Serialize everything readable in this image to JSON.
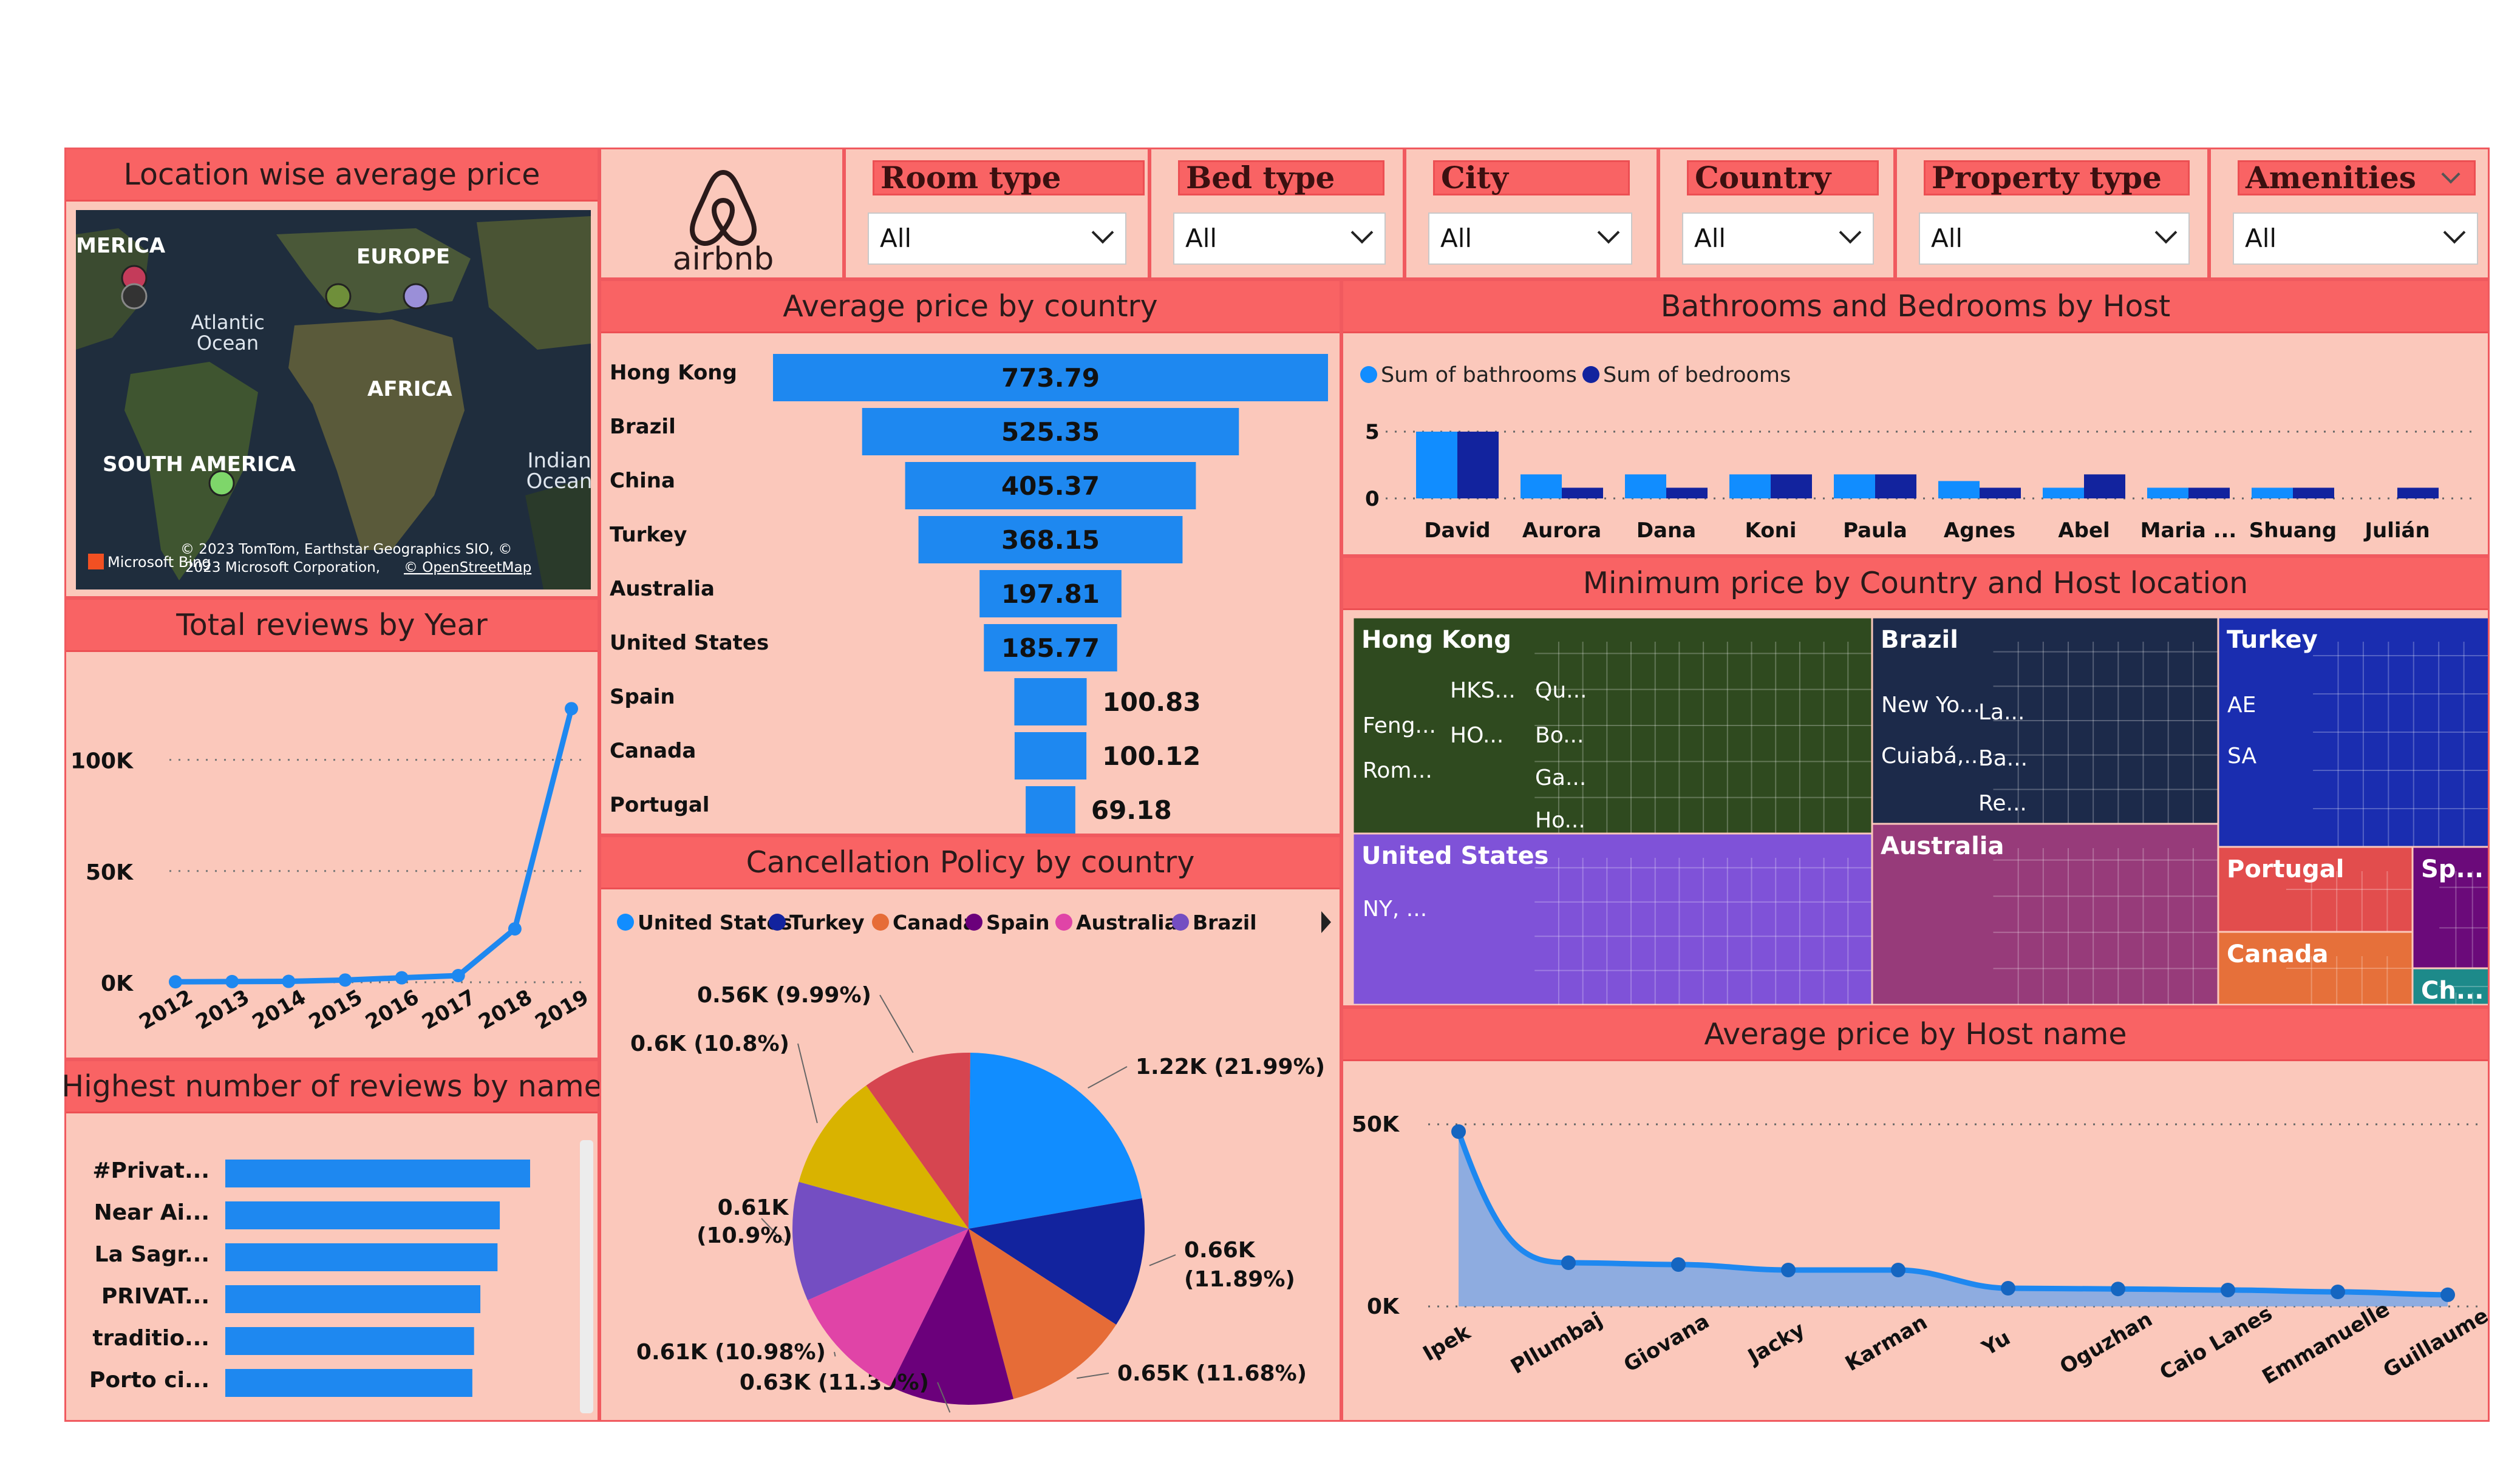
{
  "brand": {
    "name": "airbnb"
  },
  "filters": [
    {
      "title": "Room type",
      "value": "All"
    },
    {
      "title": "Bed type",
      "value": "All"
    },
    {
      "title": "City",
      "value": "All"
    },
    {
      "title": "Country",
      "value": "All"
    },
    {
      "title": "Property type",
      "value": "All"
    },
    {
      "title": "Amenities",
      "value": "All"
    }
  ],
  "panels": {
    "map": "Location wise average price",
    "reviews_year": "Total reviews by Year",
    "reviews_name": "Highest number of reviews by name",
    "avg_country": "Average price by country",
    "cancel": "Cancellation Policy by country",
    "bath_bed": "Bathrooms and Bedrooms by Host",
    "min_price": "Minimum price by Country and Host location",
    "avg_host": "Average  price by Host name"
  },
  "map": {
    "labels": [
      "MERICA",
      "EUROPE",
      "Atlantic",
      "Ocean",
      "AFRICA",
      "SOUTH AMERICA",
      "Indian",
      "Ocean"
    ],
    "attribution_1": "© 2023 TomTom, Earthstar Geographics SIO, ©",
    "attribution_2": "2023 Microsoft Corporation,",
    "attribution_link": "© OpenStreetMap",
    "bing": "Microsoft Bing"
  },
  "chart_data": [
    {
      "id": "reviews_year",
      "type": "line",
      "title": "Total reviews by Year",
      "x": [
        "2012",
        "2013",
        "2014",
        "2015",
        "2016",
        "2017",
        "2018",
        "2019"
      ],
      "values": [
        200,
        300,
        400,
        1000,
        2000,
        3000,
        24000,
        123000
      ],
      "yticks": [
        "0K",
        "50K",
        "100K"
      ],
      "ylim": [
        0,
        125000
      ]
    },
    {
      "id": "reviews_name",
      "type": "bar",
      "title": "Highest number of reviews by name",
      "categories": [
        "#Privat...",
        "Near Ai...",
        "La Sagr...",
        "PRIVAT...",
        "traditio...",
        "Porto ci..."
      ],
      "values": [
        533,
        480,
        476,
        446,
        435,
        432
      ]
    },
    {
      "id": "avg_country",
      "type": "bar",
      "title": "Average price by country",
      "categories": [
        "Hong Kong",
        "Brazil",
        "China",
        "Turkey",
        "Australia",
        "United States",
        "Spain",
        "Canada",
        "Portugal"
      ],
      "values": [
        773.79,
        525.35,
        405.37,
        368.15,
        197.81,
        185.77,
        100.83,
        100.12,
        69.18
      ],
      "labels": [
        "773.79",
        "525.35",
        "405.37",
        "368.15",
        "197.81",
        "185.77",
        "100.83",
        "100.12",
        "69.18"
      ]
    },
    {
      "id": "cancel",
      "type": "pie",
      "title": "Cancellation Policy by country",
      "legend": [
        "United States",
        "Turkey",
        "Canada",
        "Spain",
        "Australia",
        "Brazil"
      ],
      "values": [
        21.99,
        11.89,
        11.68,
        11.39,
        10.98,
        10.9,
        10.8,
        9.99
      ],
      "labels": [
        "1.22K (21.99%)",
        "0.66K (11.89%)",
        "0.65K (11.68%)",
        "0.63K (11.39%)",
        "0.61K (10.98%)",
        "0.61K (10.9%)",
        "0.6K (10.8%)",
        "0.56K (9.99%)"
      ],
      "colors": [
        "#118dff",
        "#12239e",
        "#e66c37",
        "#6b007b",
        "#e044a7",
        "#744ec2",
        "#d9b300",
        "#d64550"
      ]
    },
    {
      "id": "bath_bed",
      "type": "bar",
      "title": "Bathrooms and Bedrooms by Host",
      "categories": [
        "David",
        "Aurora",
        "Dana",
        "Koni",
        "Paula",
        "Agnes",
        "Abel",
        "Maria ...",
        "Shuang",
        "Julián"
      ],
      "series": [
        {
          "name": "Sum of bathrooms",
          "values": [
            5,
            1.8,
            1.8,
            1.8,
            1.8,
            1.3,
            0.8,
            0.8,
            0.8,
            0
          ]
        },
        {
          "name": "Sum of bedrooms",
          "values": [
            5,
            0.8,
            0.8,
            1.8,
            1.8,
            0.8,
            1.8,
            0.8,
            0.8,
            0.8
          ]
        }
      ],
      "yticks": [
        "0",
        "5"
      ],
      "ylim": [
        0,
        5
      ]
    },
    {
      "id": "min_price",
      "type": "heatmap",
      "title": "Minimum price by Country and Host location",
      "tiles": [
        {
          "label": "Hong Kong",
          "sub": [
            "Feng...",
            "Rom...",
            "HKS...",
            "HO...",
            "Qu...",
            "Bo...",
            "Ga...",
            "Ho..."
          ]
        },
        {
          "label": "Brazil",
          "sub": [
            "New Yo...",
            "Cuiabá,...",
            "La...",
            "Ba...",
            "Re..."
          ]
        },
        {
          "label": "Turkey",
          "sub": [
            "AE",
            "SA"
          ]
        },
        {
          "label": "United States",
          "sub": [
            "NY, ..."
          ]
        },
        {
          "label": "Australia",
          "sub": []
        },
        {
          "label": "Portugal",
          "sub": []
        },
        {
          "label": "Sp...",
          "sub": []
        },
        {
          "label": "Canada",
          "sub": []
        },
        {
          "label": "Ch...",
          "sub": []
        }
      ]
    },
    {
      "id": "avg_host",
      "type": "area",
      "title": "Average  price by Host name",
      "x": [
        "Ipek",
        "Pllumbaj",
        "Giovana",
        "Jacky",
        "Karman",
        "Yu",
        "Oguzhan",
        "Caio Lanes",
        "Emmanuelle",
        "Guillaume"
      ],
      "values": [
        48000,
        12000,
        11500,
        10000,
        10000,
        5000,
        4800,
        4500,
        4000,
        3200
      ],
      "yticks": [
        "0K",
        "50K"
      ],
      "ylim": [
        0,
        50000
      ]
    }
  ]
}
